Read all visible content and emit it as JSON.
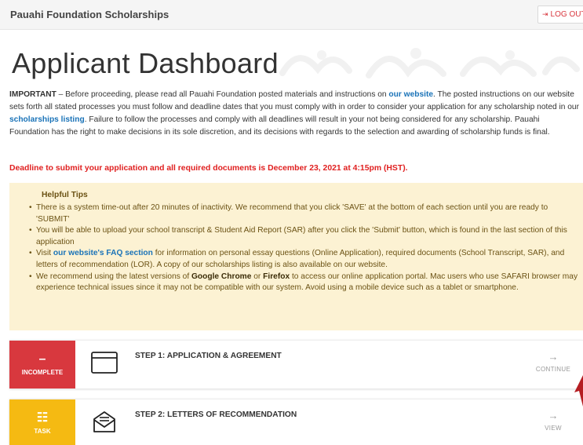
{
  "header": {
    "brand": "Pauahi Foundation Scholarships",
    "logout_label": "LOG OUT",
    "logout_icon": "sign-out-icon"
  },
  "page": {
    "title": "Applicant Dashboard"
  },
  "intro": {
    "important": "IMPORTANT",
    "p1": " – Before proceeding, please read all Pauahi Foundation posted materials and instructions on ",
    "link1": "our website",
    "p2": ". The posted instructions on our website sets forth all stated processes you must follow and deadline dates that you must comply with in order to consider your application for any scholarship noted in our ",
    "link2": "scholarships listing",
    "p3": ". Failure to follow the processes and comply with all deadlines will result in your not being considered for any scholarship. Pauahi Foundation has the right to make decisions in its sole discretion, and its decisions with regards to the selection and awarding of scholarship funds is final."
  },
  "deadline": "Deadline to submit your application and all required documents is December 23, 2021 at 4:15pm (HST).",
  "tips": {
    "title": "Helpful Tips",
    "tip1": "There is a system time-out after 20 minutes of inactivity. We recommend that you click 'SAVE' at the bottom of each section until you are ready to 'SUBMIT'",
    "tip2": "You will be able to upload your school transcript & Student Aid Report (SAR) after you click the 'Submit' button, which is found in the last section of this application",
    "tip3_a": "Visit ",
    "tip3_link": "our website's FAQ section",
    "tip3_b": " for information on personal essay questions (Online Application), required documents (School Transcript, SAR), and letters of recommendation (LOR). A copy of our scholarships listing is also available on our website.",
    "tip4_a": "We recommend using the latest versions of ",
    "tip4_chrome": "Google Chrome",
    "tip4_or": " or ",
    "tip4_firefox": "Firefox",
    "tip4_b": " to access our online application portal. Mac users who use SAFARI browser may experience technical issues since it may not be compatible with our system. Avoid using a mobile device such as a tablet or smartphone."
  },
  "steps": [
    {
      "status": "INCOMPLETE",
      "status_mark": "–",
      "status_color": "#d8383e",
      "icon": "browser-window-icon",
      "label": "STEP 1: APPLICATION & AGREEMENT",
      "action": "CONTINUE"
    },
    {
      "status": "TASK",
      "status_mark": "☷",
      "status_color": "#f5ba12",
      "icon": "envelope-letter-icon",
      "label": "STEP 2: LETTERS OF RECOMMENDATION",
      "action": "VIEW"
    }
  ]
}
